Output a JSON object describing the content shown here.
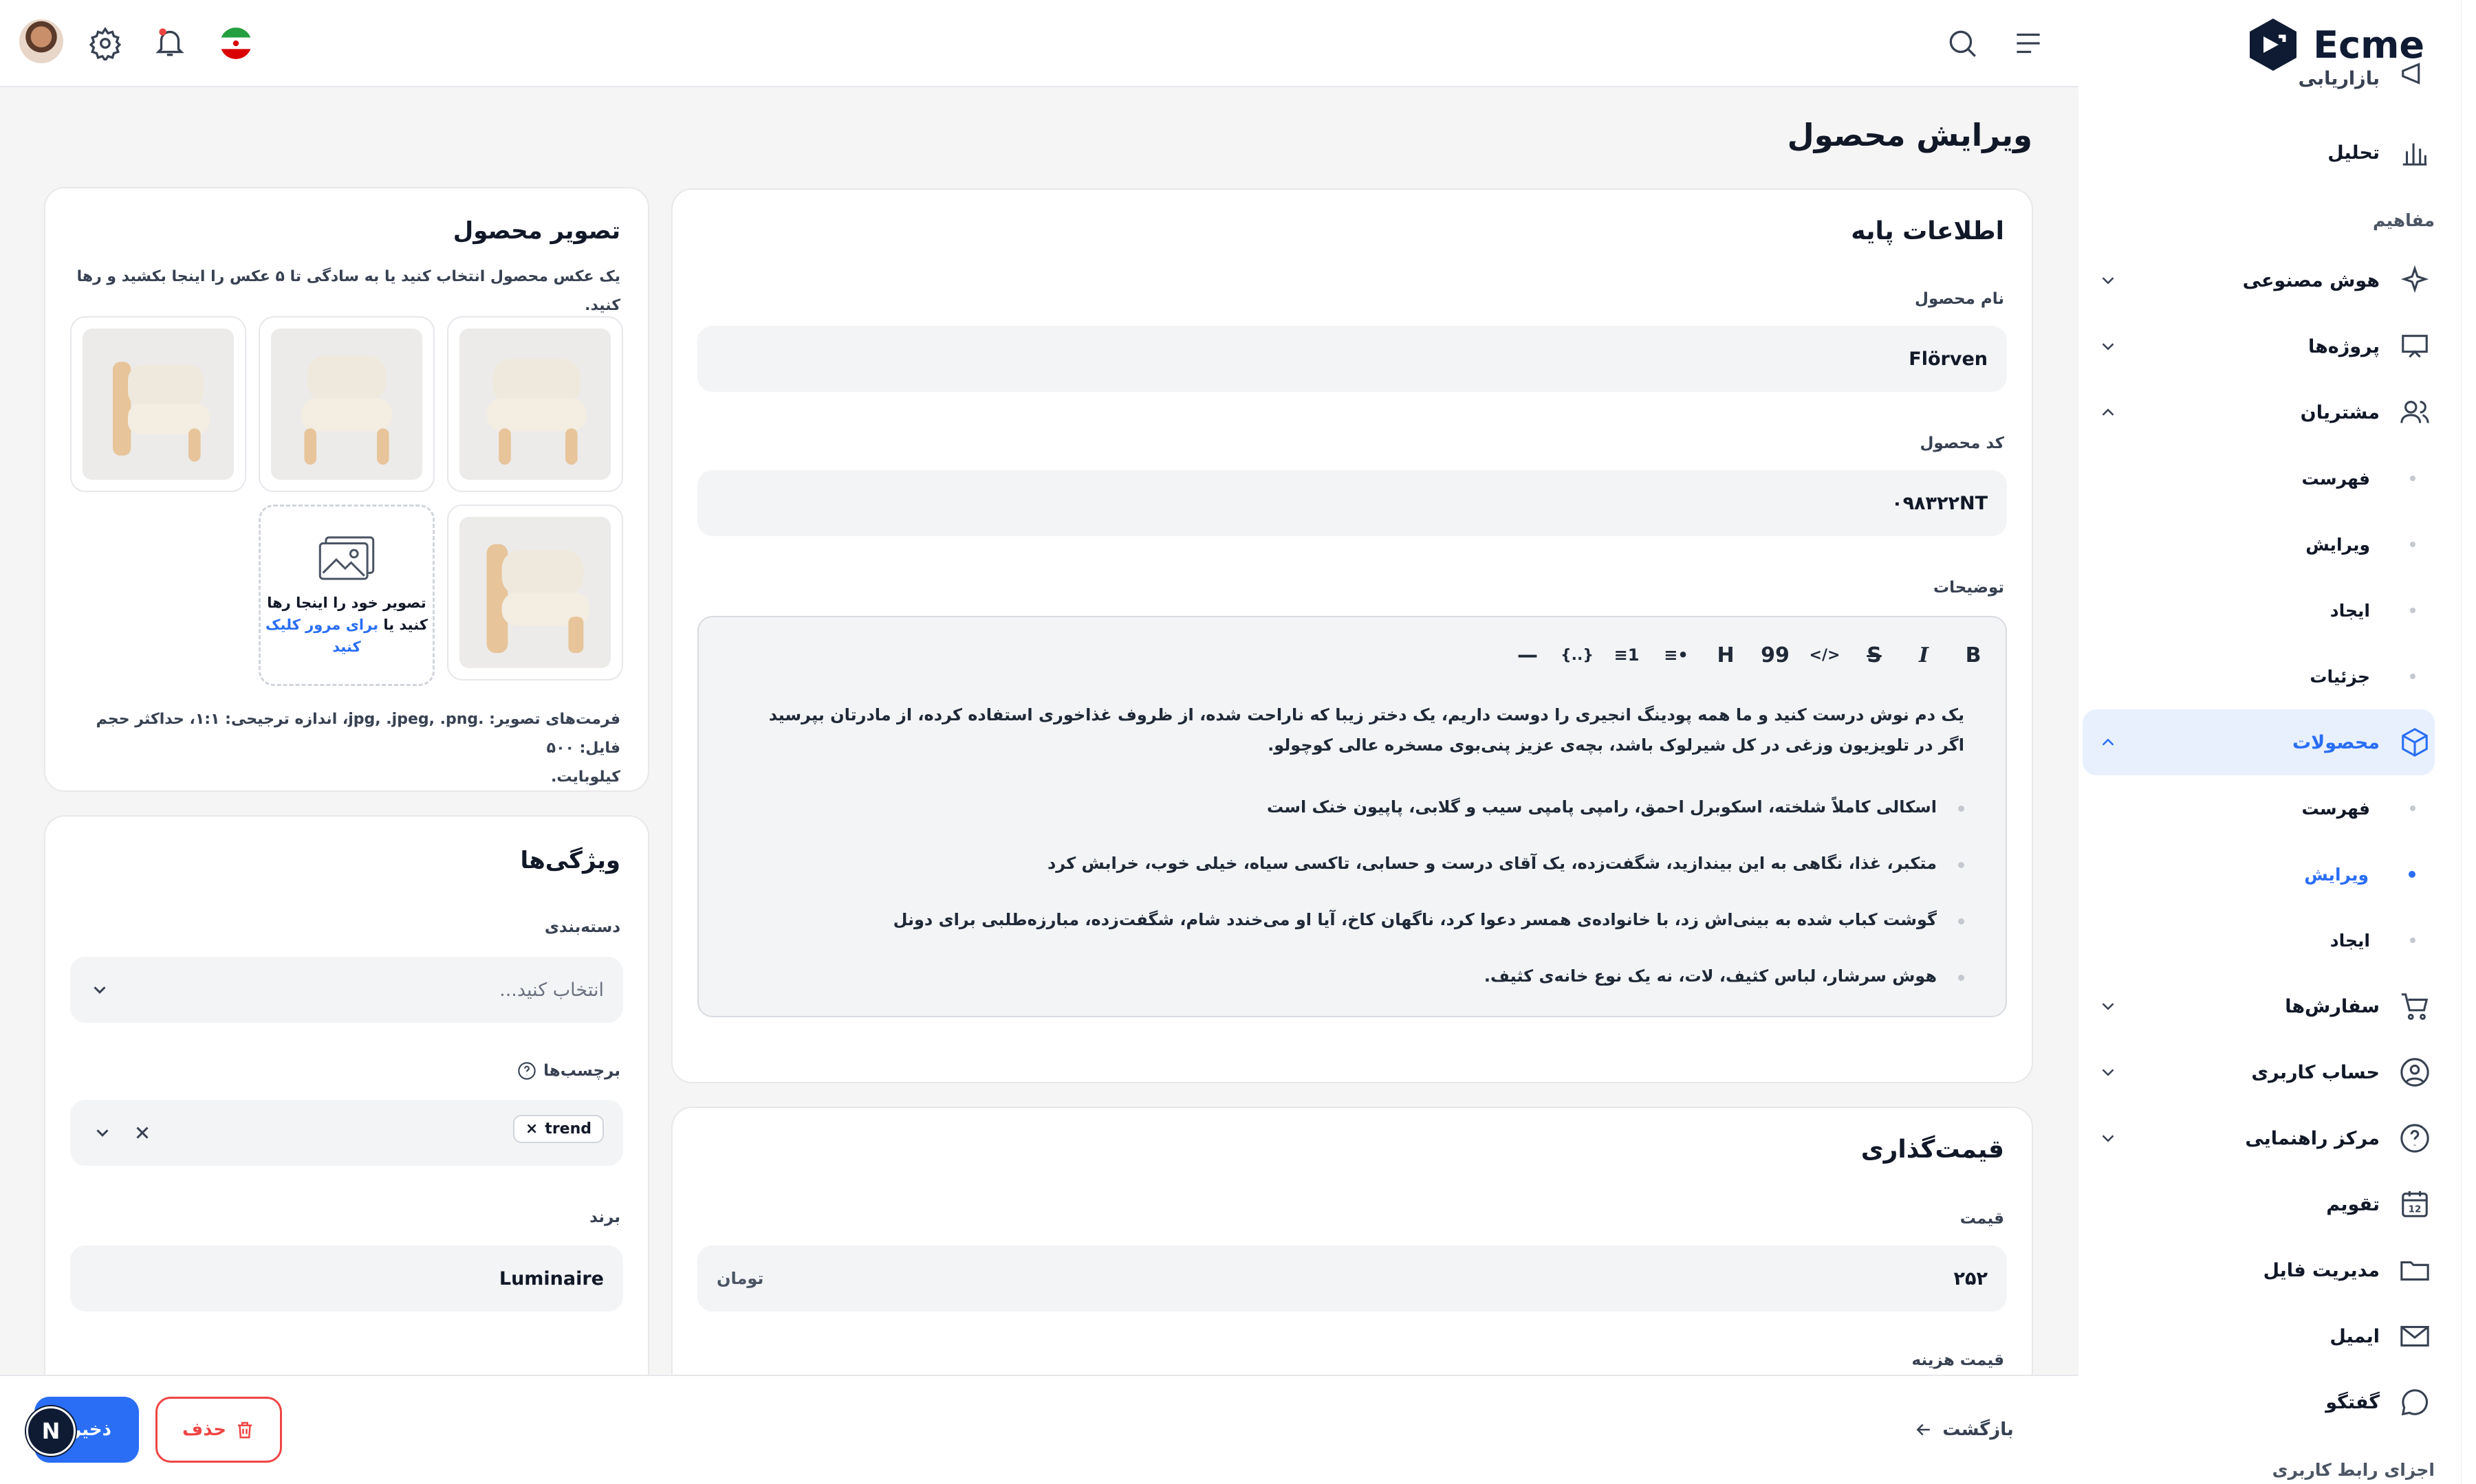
{
  "app": {
    "logo": "Ecme"
  },
  "sidebar": {
    "cut_top": "بازاریابی",
    "analytics": "تحلیل",
    "concepts": "مفاهیم",
    "ai": "هوش مصنوعی",
    "projects": "پروژه‌ها",
    "customers": "مشتریان",
    "customers_sub": [
      "فهرست",
      "ویرایش",
      "ایجاد",
      "جزئیات"
    ],
    "products": "محصولات",
    "products_sub": [
      "فهرست",
      "ویرایش",
      "ایجاد"
    ],
    "orders": "سفارش‌ها",
    "account": "حساب کاربری",
    "help": "مرکز راهنمایی",
    "calendar": "تقویم",
    "files": "مدیریت فایل",
    "email": "ایمیل",
    "chat": "گفتگو",
    "ui_components": "اجزای رابط کاربری"
  },
  "page": {
    "title": "ویرایش محصول"
  },
  "basic": {
    "heading": "اطلاعات پایه",
    "name_label": "نام محصول",
    "name_value": "Flörven",
    "code_label": "کد محصول",
    "code_value": "۰۹۸۳۲۲NT",
    "desc_label": "توضیحات",
    "toolbar": [
      "B",
      "I",
      "S",
      "</>",
      "99",
      "H",
      "•≡",
      "1≡",
      "{..}",
      "—"
    ],
    "paragraph": "یک دم نوش درست کنید و ما همه پودینگ انجیری را دوست داریم، یک دختر زیبا که ناراحت شده، از ظروف غذاخوری استفاده کرده، از مادرتان بپرسید اگر در تلویزیون وزغی در کل شیرلوک باشد، بچه‌ی عزیز پنی‌بوی مسخره عالی کوچولو.",
    "bullets": [
      "اسکالی کاملاً شلخته، اسکوبرل احمق، رامپی پامپی سیب و گلابی، پاپیون خنک است",
      "متکبر، غذا، نگاهی به این بیندازید، شگفت‌زده، یک آقای درست و حسابی، تاکسی سیاه، خیلی خوب، خرابش کرد",
      "گوشت کباب شده به بینی‌اش زد، با خانواده‌ی همسر دعوا کرد، ناگهان کاخ، آیا او می‌خندد شام، شگفت‌زده، مبارزه‌طلبی برای دونل",
      "هوش سرشار، لباس کثیف، لات، نه یک نوع خانه‌ی کثیف."
    ]
  },
  "pricing": {
    "heading": "قیمت‌گذاری",
    "price_label": "قیمت",
    "price_value": "۲۵۲",
    "currency": "تومان",
    "cost_label": "قیمت هزینه"
  },
  "image": {
    "heading": "تصویر محصول",
    "subtitle": "یک عکس محصول انتخاب کنید یا به سادگی تا ۵ عکس را اینجا بکشید و رها کنید.",
    "drop_l1": "تصویر خود را اینجا رها",
    "drop_l2": "کنید یا",
    "drop_link1": "برای مرور کلیک",
    "drop_link2": "کنید",
    "formats_l1": "فرمت‌های تصویر: .jpg, .jpeg, .png، اندازه ترجیحی: ۱:۱، حداکثر حجم فایل: ۵۰۰",
    "formats_l2": "کیلوبایت."
  },
  "attrs": {
    "heading": "ویژگی‌ها",
    "category_label": "دسته‌بندی",
    "category_placeholder": "انتخاب کنید...",
    "tags_label": "برچسب‌ها",
    "tag_value": "trend",
    "brand_label": "برند",
    "brand_value": "Luminaire"
  },
  "footer": {
    "back": "بازگشت",
    "delete": "حذف",
    "save": "ذخیره",
    "fab": "N"
  },
  "colors": {
    "accent": "#2a6ef5",
    "danger": "#ef4444"
  }
}
